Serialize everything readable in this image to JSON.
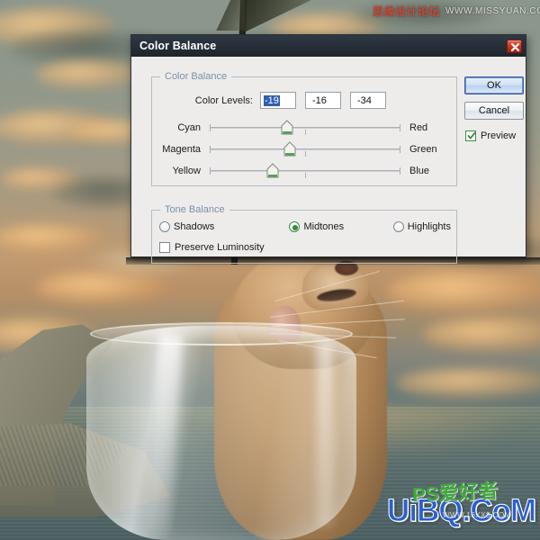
{
  "dialog": {
    "title": "Color Balance",
    "close_icon": "close-x-icon",
    "groups": {
      "color_balance": {
        "legend": "Color Balance",
        "levels_label": "Color Levels:",
        "levels": [
          {
            "value": "-19",
            "selected": true
          },
          {
            "value": "-16",
            "selected": false
          },
          {
            "value": "-34",
            "selected": false
          }
        ],
        "sliders": [
          {
            "left_label": "Cyan",
            "right_label": "Red",
            "value": -19,
            "min": -100,
            "max": 100
          },
          {
            "left_label": "Magenta",
            "right_label": "Green",
            "value": -16,
            "min": -100,
            "max": 100
          },
          {
            "left_label": "Yellow",
            "right_label": "Blue",
            "value": -34,
            "min": -100,
            "max": 100
          }
        ]
      },
      "tone_balance": {
        "legend": "Tone Balance",
        "options": [
          {
            "label": "Shadows",
            "selected": false
          },
          {
            "label": "Midtones",
            "selected": true
          },
          {
            "label": "Highlights",
            "selected": false
          }
        ],
        "preserve_luminosity": {
          "label": "Preserve Luminosity",
          "checked": false
        }
      }
    },
    "buttons": {
      "ok": "OK",
      "cancel": "Cancel"
    },
    "preview": {
      "label": "Preview",
      "checked": true
    }
  },
  "watermarks": {
    "top": {
      "cn": "思缘设计论坛",
      "en": "WWW.MISSYUAN.COM"
    },
    "bottom": {
      "big": "UiBQ.CoM",
      "cn": "PS爱好者",
      "tiny": "WWW.16XX8.COM"
    }
  },
  "colors": {
    "titlebar": "#28313b",
    "dialog_bg": "#edecea",
    "accent_selection": "#2f5fb0",
    "accent_green": "#39893f",
    "close_red": "#c9301c",
    "group_legend": "#7d90a8",
    "watermark_blue": "#2a5fd0",
    "watermark_green": "#3faa3a",
    "watermark_red": "#c64b3a"
  }
}
